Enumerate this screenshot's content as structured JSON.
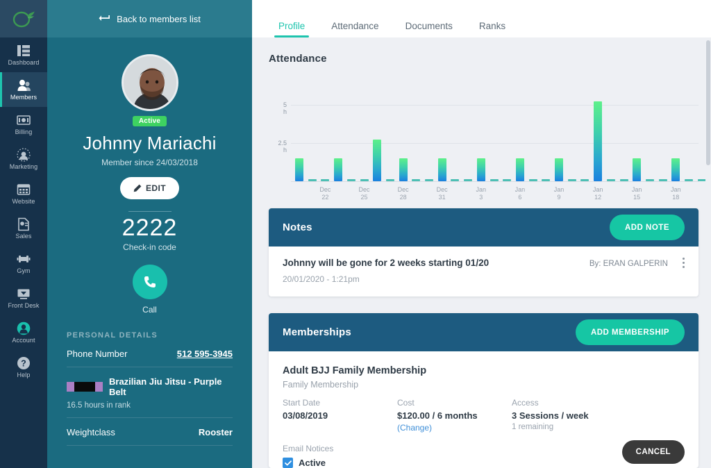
{
  "sidebar": {
    "logo_icon": "leaf-circle-logo",
    "items": [
      {
        "label": "Dashboard",
        "icon": "dashboard-icon",
        "active": false
      },
      {
        "label": "Members",
        "icon": "members-icon",
        "active": true
      },
      {
        "label": "Billing",
        "icon": "billing-icon",
        "active": false
      },
      {
        "label": "Marketing",
        "icon": "marketing-icon",
        "active": false
      },
      {
        "label": "Website",
        "icon": "website-icon",
        "active": false
      },
      {
        "label": "Sales",
        "icon": "sales-icon",
        "active": false
      },
      {
        "label": "Gym",
        "icon": "gym-icon",
        "active": false
      },
      {
        "label": "Front Desk",
        "icon": "front-desk-icon",
        "active": false
      },
      {
        "label": "Account",
        "icon": "account-icon",
        "active": false
      },
      {
        "label": "Help",
        "icon": "help-icon",
        "active": false
      }
    ]
  },
  "member_panel": {
    "back_label": "Back to members list",
    "back_icon": "back-arrow-icon",
    "status_badge": "Active",
    "name": "Johnny Mariachi",
    "member_since": "Member since 24/03/2018",
    "edit_label": "EDIT",
    "edit_icon": "pencil-icon",
    "checkin_code": "2222",
    "checkin_label": "Check-in code",
    "call_label": "Call",
    "call_icon": "phone-icon",
    "personal_details_title": "PERSONAL DETAILS",
    "phone_key": "Phone Number",
    "phone_value": "512 595-3945",
    "belt_name": "Brazilian Jiu Jitsu - Purple Belt",
    "belt_hours": "16.5 hours in rank",
    "weightclass_key": "Weightclass",
    "weightclass_value": "Rooster"
  },
  "tabs": [
    {
      "label": "Profile",
      "active": true
    },
    {
      "label": "Attendance",
      "active": false
    },
    {
      "label": "Documents",
      "active": false
    },
    {
      "label": "Ranks",
      "active": false
    }
  ],
  "attendance": {
    "title": "Attendance"
  },
  "chart_data": {
    "type": "bar",
    "title": "Attendance",
    "xlabel": "",
    "ylabel": "h",
    "ylim": [
      0,
      7
    ],
    "grid": true,
    "legend": false,
    "y_ticks": [
      {
        "value": 5,
        "label": "5 h"
      },
      {
        "value": 2.5,
        "label": "2.5 h"
      }
    ],
    "x_tick_labels": [
      "Dec 22",
      "Dec 25",
      "Dec 28",
      "Dec 31",
      "Jan 3",
      "Jan 6",
      "Jan 9",
      "Jan 12",
      "Jan 15",
      "Jan 18"
    ],
    "x_tick_indices": [
      2,
      5,
      8,
      11,
      14,
      17,
      20,
      23,
      26,
      29
    ],
    "categories": [
      "Dec 20",
      "Dec 21",
      "Dec 22",
      "Dec 23",
      "Dec 24",
      "Dec 25",
      "Dec 26",
      "Dec 27",
      "Dec 28",
      "Dec 29",
      "Dec 30",
      "Dec 31",
      "Jan 1",
      "Jan 2",
      "Jan 3",
      "Jan 4",
      "Jan 5",
      "Jan 6",
      "Jan 7",
      "Jan 8",
      "Jan 9",
      "Jan 10",
      "Jan 11",
      "Jan 12",
      "Jan 13",
      "Jan 14",
      "Jan 15",
      "Jan 16",
      "Jan 17",
      "Jan 18",
      "Jan 19",
      "Jan 20"
    ],
    "values": [
      1.5,
      0.05,
      0.05,
      1.5,
      0.05,
      0.05,
      2.75,
      0.05,
      1.5,
      0.05,
      0.05,
      1.5,
      0.05,
      0.05,
      1.5,
      0.05,
      0.05,
      1.5,
      0.05,
      0.05,
      1.5,
      0.05,
      0.05,
      5.25,
      0.05,
      0.05,
      1.5,
      0.05,
      0.05,
      1.5,
      0.05,
      0.05
    ],
    "extra_values": [
      1.5,
      1.5
    ],
    "bar_gradient": [
      "#5ef08a",
      "#1a80df"
    ]
  },
  "notes": {
    "title": "Notes",
    "add_label": "ADD NOTE",
    "items": [
      {
        "text": "Johnny will be gone for 2 weeks starting 01/20",
        "date": "20/01/2020 - 1:21pm",
        "by": "By: ERAN GALPERIN"
      }
    ]
  },
  "memberships": {
    "title": "Memberships",
    "add_label": "ADD MEMBERSHIP",
    "item": {
      "name": "Adult BJJ Family Membership",
      "type": "Family Membership",
      "start_date_key": "Start Date",
      "start_date_value": "03/08/2019",
      "cost_key": "Cost",
      "cost_value": "$120.00 / 6 months",
      "cost_change_link": "(Change)",
      "access_key": "Access",
      "access_value": "3 Sessions / week",
      "access_sub": "1 remaining",
      "cancel_label": "CANCEL",
      "email_notices_key": "Email Notices",
      "email_notices_value": "Active",
      "email_notices_checked": true
    }
  },
  "colors": {
    "accent_teal": "#16c6a4",
    "sidebar_bg": "#16314a",
    "panel_bg": "#1b6b80",
    "card_head": "#1d5b80",
    "status_green": "#3ed261",
    "link_blue": "#3f8fd8"
  }
}
